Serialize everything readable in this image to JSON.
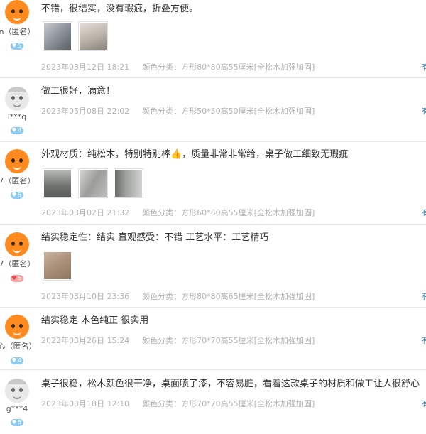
{
  "reviews": [
    {
      "username": "n（匿名）",
      "avatar": "orange",
      "level": "5",
      "level_color": "#8fcaf0",
      "text": "不错，很结实，没有瑕疵，折叠方便。",
      "photos": [
        "#9aa0a8",
        "#c8c2ba"
      ],
      "date": "2023年03月12日 18:21",
      "spec": "颜色分类：方形80*80高55厘米[全松木加强加固]",
      "action": "有"
    },
    {
      "username": "l***q",
      "avatar": "gray",
      "level": "4",
      "level_color": "#8fcaf0",
      "text": "做工很好，满意！",
      "photos": [],
      "date": "2023年05月08日 22:02",
      "spec": "颜色分类：方形50*50高50厘米[全松木加强加固]",
      "action": "有"
    },
    {
      "username": "7（匿名）",
      "avatar": "orange",
      "level": "5",
      "level_color": "#8fcaf0",
      "text": "外观材质：纯松木，特别特别棒👍，质量非常非常给，桌子做工细致无瑕疵",
      "photos": [
        "#8c8f8a",
        "#a9aaa8",
        "#7f817f"
      ],
      "date": "2023年03月02日 21:32",
      "spec": "颜色分类：方形60*60高55厘米[全松木加强加固]",
      "action": "有"
    },
    {
      "username": "7（匿名）",
      "avatar": "orange",
      "level": "5",
      "level_color": "#f6a3a3",
      "text": "结实稳定性：结实 直观感受：不错 工艺水平：工艺精巧",
      "photos": [
        "#b39a85"
      ],
      "date": "2023年03月10日 23:36",
      "spec": "颜色分类：方形80*80高65厘米[全松木加强加固]",
      "action": "有"
    },
    {
      "username": "心（匿名）",
      "avatar": "orange",
      "level": "4",
      "level_color": "#8fcaf0",
      "text": "结实稳定 木色纯正 很实用",
      "photos": [],
      "date": "2023年03月26日 15:24",
      "spec": "颜色分类：方形70*70高55厘米[全松木加强加固]",
      "action": "有"
    },
    {
      "username": "g***4",
      "avatar": "gray",
      "level": "5",
      "level_color": "#8fcaf0",
      "text": "桌子很稳，松木颜色很干净，桌面喷了漆，不容易脏，看着这款桌子的材质和做工让人很舒心",
      "photos": [],
      "date": "2023年03月18日 12:10",
      "spec": "颜色分类：方形70*70高55厘米[全松木加强加固]",
      "action": "有"
    }
  ]
}
